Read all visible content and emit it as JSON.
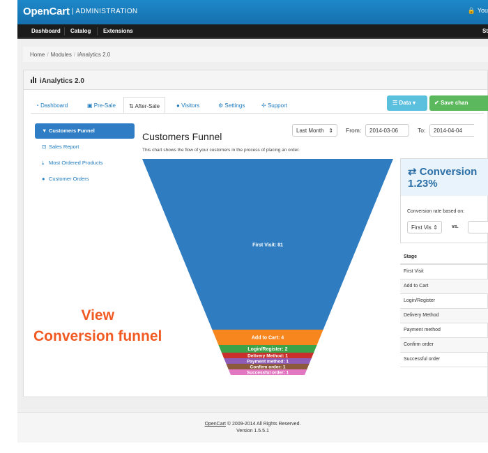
{
  "header": {
    "brand": "OpenCart",
    "subtitle": "| ADMINISTRATION",
    "user": "You"
  },
  "menu": {
    "items": [
      "Dashboard",
      "Catalog",
      "Extensions"
    ],
    "right": "St"
  },
  "breadcrumb": {
    "items": [
      "Home",
      "Modules",
      "iAnalytics 2.0"
    ],
    "separator": "/"
  },
  "panel": {
    "title": "iAnalytics 2.0"
  },
  "tabs": [
    {
      "label": "Dashboard",
      "icon": "dashboard-icon",
      "glyph": "◔"
    },
    {
      "label": "Pre-Sale",
      "icon": "monitor-icon",
      "glyph": "▣"
    },
    {
      "label": "After-Sale",
      "icon": "sort-icon",
      "glyph": "⇅"
    },
    {
      "label": "Visitors",
      "icon": "user-icon",
      "glyph": "●"
    },
    {
      "label": "Settings",
      "icon": "gears-icon",
      "glyph": "⚙"
    },
    {
      "label": "Support",
      "icon": "lifebuoy-icon",
      "glyph": "✢"
    }
  ],
  "buttons": {
    "data_label": "Data",
    "data_icon": "☰",
    "caret": "▾",
    "save_label": "Save chan",
    "save_icon": "✔"
  },
  "sidebar": [
    {
      "label": "Customers Funnel",
      "glyph": "▼"
    },
    {
      "label": "Sales Report",
      "glyph": "⊡"
    },
    {
      "label": "Most Ordered Products",
      "glyph": "⤓"
    },
    {
      "label": "Customer Orders",
      "glyph": "●"
    }
  ],
  "report": {
    "title": "Customers Funnel",
    "description": "This chart shows the flow of your customers in the process of placing an order.",
    "period": "Last Month",
    "from_label": "From:",
    "from": "2014-03-06",
    "to_label": "To:",
    "to": "2014-04-04"
  },
  "overlay": {
    "line1": "View",
    "line2": "Conversion funnel"
  },
  "conversion": {
    "icon": "⇄",
    "title": "Conversion",
    "rate": "1.23%",
    "based_on_label": "Conversion rate based on:",
    "select_value": "First Vis",
    "vs_label": "vs."
  },
  "stage_table": {
    "header": "Stage",
    "rows": [
      "First Visit",
      "Add to Cart",
      "Login/Register",
      "Delivery Method",
      "Payment method",
      "Confirm order",
      "Successful order"
    ]
  },
  "chart_data": {
    "type": "funnel",
    "stages": [
      {
        "label": "First Visit: 81",
        "value": 81,
        "color": "#2f7dc0"
      },
      {
        "label": "Add to Cart: 4",
        "value": 4,
        "color": "#f7861f"
      },
      {
        "label": "Login/Register: 2",
        "value": 2,
        "color": "#3ca24a"
      },
      {
        "label": "Delivery Method: 1",
        "value": 1,
        "color": "#c9302c"
      },
      {
        "label": "Payment method: 1",
        "value": 1,
        "color": "#8e5cb6"
      },
      {
        "label": "Confirm order: 1",
        "value": 1,
        "color": "#8b5a3c"
      },
      {
        "label": "Successful order: 1",
        "value": 1,
        "color": "#e377c2"
      }
    ]
  },
  "footer": {
    "link": "OpenCart",
    "text": " © 2009-2014 All Rights Reserved.",
    "version": "Version 1.5.5.1"
  }
}
